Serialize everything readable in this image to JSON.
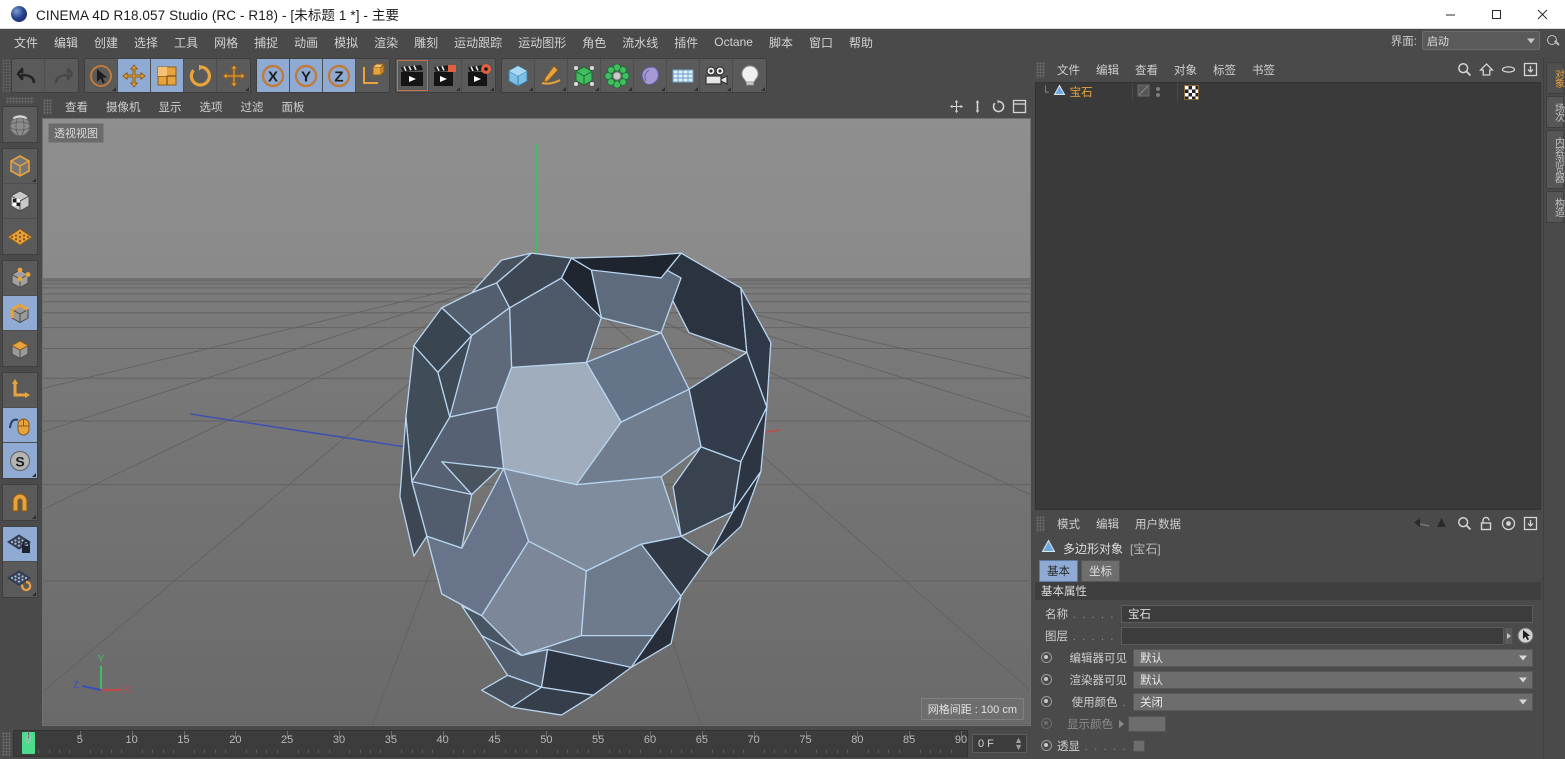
{
  "window": {
    "title": "CINEMA 4D R18.057 Studio (RC - R18) - [未标题 1 *] - 主要",
    "app_icon": "c4d-logo-icon",
    "minimize": "–",
    "maximize": "☐",
    "close": "✕"
  },
  "menubar": {
    "items": [
      {
        "label": "文件"
      },
      {
        "label": "编辑"
      },
      {
        "label": "创建"
      },
      {
        "label": "选择"
      },
      {
        "label": "工具"
      },
      {
        "label": "网格"
      },
      {
        "label": "捕捉"
      },
      {
        "label": "动画"
      },
      {
        "label": "模拟"
      },
      {
        "label": "渲染"
      },
      {
        "label": "雕刻"
      },
      {
        "label": "运动跟踪"
      },
      {
        "label": "运动图形"
      },
      {
        "label": "角色"
      },
      {
        "label": "流水线"
      },
      {
        "label": "插件"
      },
      {
        "label": "Octane"
      },
      {
        "label": "脚本"
      },
      {
        "label": "窗口"
      },
      {
        "label": "帮助"
      }
    ],
    "interface_label": "界面:",
    "interface_value": "启动",
    "search_icon": "search-icon"
  },
  "toolbar": {
    "groups": [
      {
        "buttons": [
          {
            "name": "undo-button",
            "icon": "undo-arrow-icon",
            "active": false
          },
          {
            "name": "redo-button",
            "icon": "redo-arrow-icon",
            "active": false
          }
        ]
      },
      {
        "buttons": [
          {
            "name": "live-selection-button",
            "icon": "cursor-circle-icon",
            "active": false
          },
          {
            "name": "move-tool-button",
            "icon": "move-arrows-icon",
            "active": true
          },
          {
            "name": "scale-tool-button",
            "icon": "scale-box-icon",
            "active": true
          },
          {
            "name": "rotate-tool-button",
            "icon": "rotate-arc-icon",
            "active": false
          },
          {
            "name": "transform-tool-button",
            "icon": "move-arrows-icon",
            "active": false
          }
        ]
      },
      {
        "buttons": [
          {
            "name": "lock-x-axis-button",
            "icon": "x-axis-icon",
            "label": "X",
            "active": true
          },
          {
            "name": "lock-y-axis-button",
            "icon": "y-axis-icon",
            "label": "Y",
            "active": true
          },
          {
            "name": "lock-z-axis-button",
            "icon": "z-axis-icon",
            "label": "Z",
            "active": true
          },
          {
            "name": "world-object-coordinates-button",
            "icon": "coordinate-cube-icon",
            "active": false
          }
        ]
      },
      {
        "buttons": [
          {
            "name": "render-view-button",
            "icon": "render-clapper-icon",
            "active": false
          },
          {
            "name": "render-region-button",
            "icon": "render-region-icon",
            "active": false
          },
          {
            "name": "render-settings-button",
            "icon": "render-settings-icon",
            "active": false
          }
        ]
      },
      {
        "buttons": [
          {
            "name": "add-cube-button",
            "icon": "cube-primitive-icon",
            "active": false
          },
          {
            "name": "add-spline-button",
            "icon": "spline-pen-icon",
            "active": false
          },
          {
            "name": "add-generator-button",
            "icon": "generator-icon",
            "active": false
          },
          {
            "name": "add-deformer-button",
            "icon": "deformer-icon",
            "active": false
          },
          {
            "name": "add-scene-object-button",
            "icon": "scene-object-icon",
            "active": false
          },
          {
            "name": "add-mograph-button",
            "icon": "mograph-grid-icon",
            "active": false
          },
          {
            "name": "add-camera-button",
            "icon": "camera-icon",
            "active": false
          },
          {
            "name": "add-light-button",
            "icon": "light-bulb-icon",
            "active": false
          }
        ]
      }
    ]
  },
  "leftbar": {
    "groups": [
      {
        "buttons": [
          {
            "name": "viewport-navigation-gizmo",
            "icon": "navigation-globe-icon",
            "active": false
          }
        ]
      },
      {
        "buttons": [
          {
            "name": "model-mode-button",
            "icon": "model-cube-icon",
            "active": false
          },
          {
            "name": "texture-mode-button",
            "icon": "texture-cube-icon",
            "active": false
          },
          {
            "name": "workplane-mode-button",
            "icon": "grid-plane-icon",
            "active": false
          }
        ]
      },
      {
        "buttons": [
          {
            "name": "points-mode-button",
            "icon": "points-cube-icon",
            "active": false
          },
          {
            "name": "edges-mode-button",
            "icon": "edges-cube-icon",
            "active": true
          },
          {
            "name": "polygons-mode-button",
            "icon": "polygons-cube-icon",
            "active": false
          }
        ]
      },
      {
        "buttons": [
          {
            "name": "enable-axis-modification-button",
            "icon": "axis-corner-icon",
            "active": false
          },
          {
            "name": "spline-mouse-button",
            "icon": "spline-mouse-icon",
            "active": true
          },
          {
            "name": "snap-settings-button",
            "icon": "snap-s-icon",
            "label": "S",
            "active": true
          }
        ]
      },
      {
        "buttons": [
          {
            "name": "magnet-tool-button",
            "icon": "magnet-icon",
            "active": false
          }
        ]
      },
      {
        "buttons": [
          {
            "name": "lock-workplane-button",
            "icon": "workplane-lock-icon",
            "active": true
          },
          {
            "name": "planar-workplane-button",
            "icon": "workplane-rotate-icon",
            "active": false
          }
        ]
      }
    ]
  },
  "viewport": {
    "menus": [
      {
        "label": "查看"
      },
      {
        "label": "摄像机"
      },
      {
        "label": "显示"
      },
      {
        "label": "选项"
      },
      {
        "label": "过滤"
      },
      {
        "label": "面板"
      }
    ],
    "view_label": "透视视图",
    "status": "网格间距 : 100 cm",
    "icons": [
      {
        "name": "move-view-icon"
      },
      {
        "name": "scale-view-icon"
      },
      {
        "name": "rotate-view-icon"
      },
      {
        "name": "maximize-view-icon"
      }
    ],
    "axis_gizmo": {
      "x": "X",
      "y": "Y",
      "z": "Z",
      "x_color": "#cc4444",
      "y_color": "#44bb44",
      "z_color": "#4466cc"
    },
    "object_wire_color": "#b8d4ee",
    "object_name": "truncated-icosahedron"
  },
  "timeline": {
    "start": 0,
    "end": 90,
    "step": 5,
    "playhead_frame": 0,
    "frame_field": "0 F"
  },
  "object_manager": {
    "menus": [
      {
        "label": "文件"
      },
      {
        "label": "编辑"
      },
      {
        "label": "查看"
      },
      {
        "label": "对象"
      },
      {
        "label": "标签"
      },
      {
        "label": "书签"
      }
    ],
    "icons": [
      {
        "name": "search-icon"
      },
      {
        "name": "home-icon"
      },
      {
        "name": "ellipse-icon"
      },
      {
        "name": "layout-icon"
      }
    ],
    "objects": [
      {
        "name": "宝石",
        "icon": "polygon-object-icon",
        "tag": "texture-tag-icon"
      }
    ]
  },
  "attribute_manager": {
    "menus": [
      {
        "label": "模式"
      },
      {
        "label": "编辑"
      },
      {
        "label": "用户数据"
      }
    ],
    "icons": [
      {
        "name": "back-arrow-icon"
      },
      {
        "name": "up-arrow-icon"
      },
      {
        "name": "search-icon"
      },
      {
        "name": "lock-icon"
      },
      {
        "name": "target-icon"
      },
      {
        "name": "layout-icon"
      }
    ],
    "object_header": "多边形对象",
    "object_header_name": "[宝石]",
    "tabs": [
      {
        "label": "基本",
        "active": true
      },
      {
        "label": "坐标",
        "active": false
      }
    ],
    "section_title": "基本属性",
    "properties": [
      {
        "label": "名称",
        "dots": " . . . . .",
        "type": "text",
        "value": "宝石",
        "radio": false,
        "enabled": true
      },
      {
        "label": "图层",
        "dots": " . . . . .",
        "type": "layer",
        "value": "",
        "radio": false,
        "enabled": true
      },
      {
        "label": "编辑器可见",
        "dots": "",
        "type": "dropdown",
        "value": "默认",
        "radio": true,
        "enabled": true
      },
      {
        "label": "渲染器可见",
        "dots": "",
        "type": "dropdown",
        "value": "默认",
        "radio": true,
        "enabled": true
      },
      {
        "label": "使用颜色",
        "dots": " .",
        "type": "dropdown",
        "value": "关闭",
        "radio": true,
        "enabled": true
      },
      {
        "label": "显示颜色",
        "dots": "",
        "type": "swatch",
        "value": "",
        "radio": true,
        "enabled": false
      },
      {
        "label": "透显",
        "dots": " . . . . .",
        "type": "checkbox",
        "value": "",
        "radio": true,
        "enabled": true
      }
    ]
  },
  "right_tabs": [
    {
      "label": "对象",
      "active": true
    },
    {
      "label": "场次",
      "active": false
    },
    {
      "label": "内容浏览器",
      "active": false
    },
    {
      "label": "构造",
      "active": false
    }
  ],
  "colors": {
    "accent_blue": "#8fabd4",
    "accent_orange": "#e8a33d",
    "panel_bg": "#4a4a4a",
    "field_bg": "#3c3c3c"
  }
}
